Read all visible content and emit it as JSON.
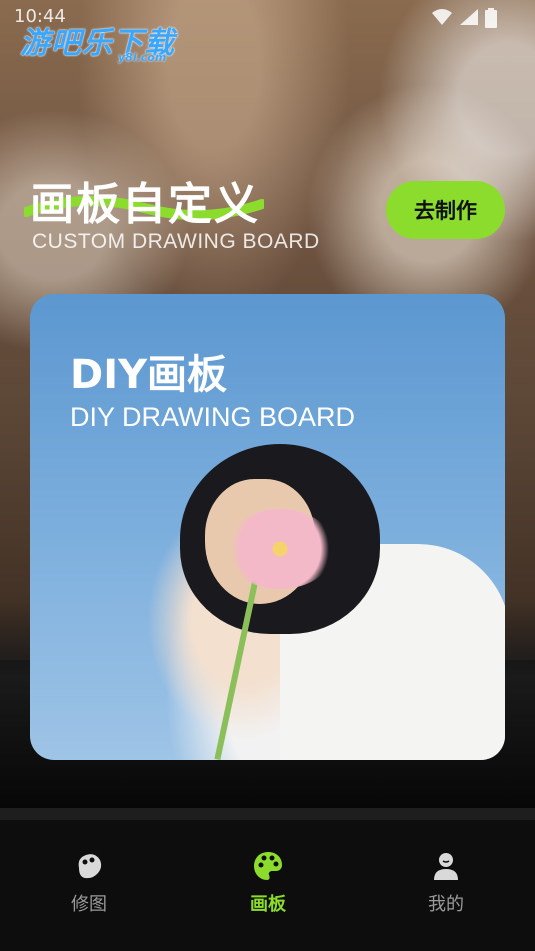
{
  "status_bar": {
    "time": "10:44"
  },
  "watermark": {
    "cn": "游吧乐下载",
    "en": "y8l.com"
  },
  "hero": {
    "title_cn": "画板自定义",
    "title_en": "CUSTOM DRAWING BOARD",
    "make_button": "去制作"
  },
  "card": {
    "title": "DIY画板",
    "subtitle": "DIY DRAWING BOARD"
  },
  "tabs": [
    {
      "label": "修图",
      "icon": "photo-edit-icon",
      "active": false
    },
    {
      "label": "画板",
      "icon": "palette-icon",
      "active": true
    },
    {
      "label": "我的",
      "icon": "profile-icon",
      "active": false
    }
  ],
  "colors": {
    "accent": "#8bdc2c",
    "inactive": "#9a9a9a",
    "tab_bg": "#0d0d0d"
  }
}
